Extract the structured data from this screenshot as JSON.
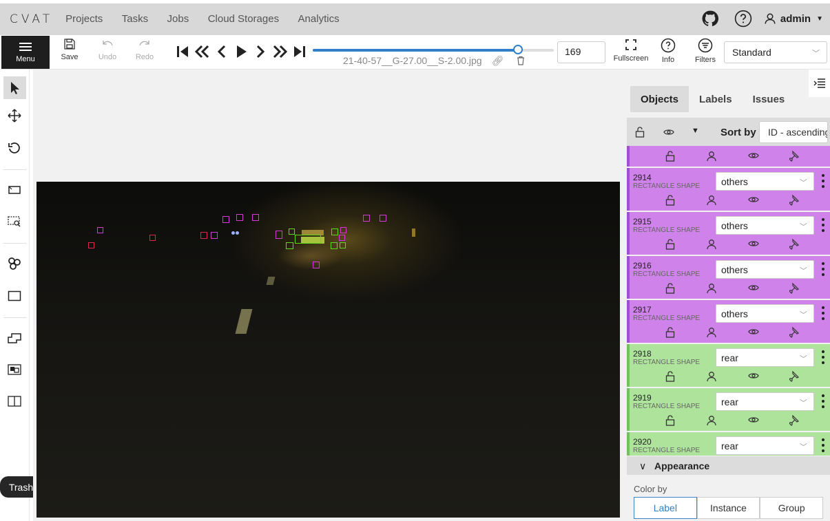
{
  "header": {
    "logo": "CVAT",
    "nav": [
      "Projects",
      "Tasks",
      "Jobs",
      "Cloud Storages",
      "Analytics"
    ],
    "user": "admin",
    "icons": [
      "github-icon",
      "help-icon",
      "user-icon"
    ]
  },
  "toolbar": {
    "menu_label": "Menu",
    "save_label": "Save",
    "undo_label": "Undo",
    "redo_label": "Redo",
    "filename": "21-40-57__G-27.00__S-2.00.jpg",
    "frame_number": "169",
    "slider_fraction": 0.85,
    "fullscreen_label": "Fullscreen",
    "info_label": "Info",
    "filters_label": "Filters",
    "workspace": "Standard"
  },
  "left_tools": {
    "tooltip": "Trash"
  },
  "sidebar": {
    "tabs": [
      "Objects",
      "Labels",
      "Issues"
    ],
    "sort_label": "Sort by",
    "sort_value": "ID - ascending",
    "objects": [
      {
        "id": "",
        "type": "",
        "label": "",
        "color": "#cf82e9"
      },
      {
        "id": "2914",
        "type": "RECTANGLE SHAPE",
        "label": "others",
        "color": "#cf82e9"
      },
      {
        "id": "2915",
        "type": "RECTANGLE SHAPE",
        "label": "others",
        "color": "#cf82e9"
      },
      {
        "id": "2916",
        "type": "RECTANGLE SHAPE",
        "label": "others",
        "color": "#cf82e9"
      },
      {
        "id": "2917",
        "type": "RECTANGLE SHAPE",
        "label": "others",
        "color": "#cf82e9"
      },
      {
        "id": "2918",
        "type": "RECTANGLE SHAPE",
        "label": "rear",
        "color": "#aee39c"
      },
      {
        "id": "2919",
        "type": "RECTANGLE SHAPE",
        "label": "rear",
        "color": "#aee39c"
      },
      {
        "id": "2920",
        "type": "RECTANGLE SHAPE",
        "label": "rear",
        "color": "#aee39c"
      }
    ],
    "appearance_label": "Appearance",
    "color_by_label": "Color by",
    "color_by_options": [
      "Label",
      "Instance",
      "Group"
    ],
    "color_by_selected": "Label"
  },
  "colors": {
    "others_border": "#d43bd4",
    "rear_border": "#5edb1e",
    "others_strip": "#a24ed0",
    "rear_strip": "#6fc35a",
    "accent": "#2f80c7"
  }
}
